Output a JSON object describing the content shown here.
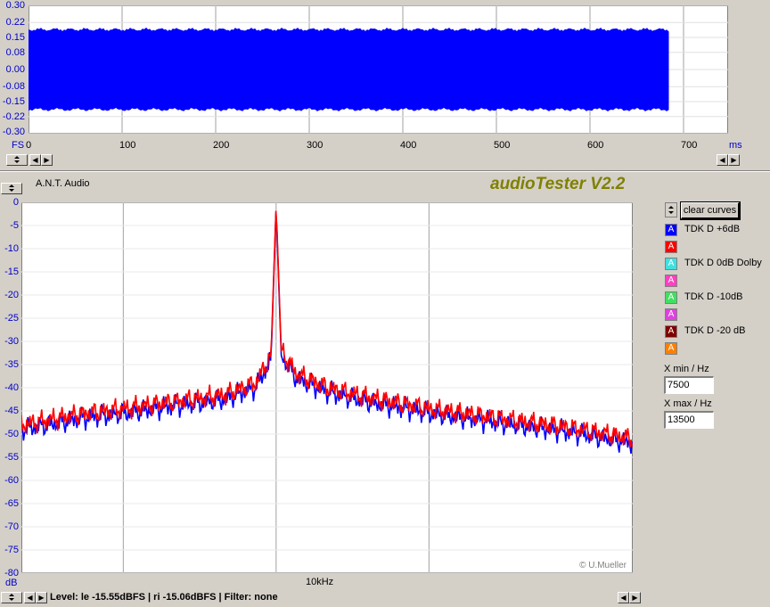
{
  "app_title": "audioTester V2.2",
  "device_label": "A.N.T. Audio",
  "copyright": "© U.Mueller",
  "status_text": "Level: le -15.55dBFS | ri -15.06dBFS | Filter: none",
  "clear_button": "clear curves",
  "legend": [
    {
      "label": "TDK D +6dB",
      "color": "#0000ff",
      "letter": "A"
    },
    {
      "label": "",
      "color": "#ff0000",
      "letter": "A"
    },
    {
      "label": "TDK D 0dB Dolby",
      "color": "#40e0e0",
      "letter": "A"
    },
    {
      "label": "",
      "color": "#ff40c0",
      "letter": "A"
    },
    {
      "label": "TDK D -10dB",
      "color": "#40e060",
      "letter": "A"
    },
    {
      "label": "",
      "color": "#e040e0",
      "letter": "A"
    },
    {
      "label": "TDK D -20 dB",
      "color": "#800000",
      "letter": "A"
    },
    {
      "label": "",
      "color": "#ff8000",
      "letter": "A"
    }
  ],
  "x_min": {
    "label": "X min / Hz",
    "value": "7500"
  },
  "x_max": {
    "label": "X max / Hz",
    "value": "13500"
  },
  "chart_data": [
    {
      "type": "area",
      "series_color": "#0000ff",
      "y_unit": "FS",
      "x_unit": "ms",
      "xlim": [
        0,
        700
      ],
      "ylim": [
        -0.3,
        0.3
      ],
      "y_ticks": [
        "0.30",
        "0.22",
        "0.15",
        "0.08",
        "0.00",
        "-0.08",
        "-0.15",
        "-0.22",
        "-0.30"
      ],
      "x_ticks": [
        "0",
        "100",
        "200",
        "300",
        "400",
        "500",
        "600",
        "700"
      ],
      "envelope": {
        "x_end": 684,
        "upper": 0.185,
        "lower": -0.185
      }
    },
    {
      "type": "line",
      "xlabel": "10kHz",
      "y_unit": "dB",
      "xlim": [
        7500,
        13500
      ],
      "ylim": [
        -80,
        0
      ],
      "y_ticks": [
        "0",
        "-5",
        "-10",
        "-15",
        "-20",
        "-25",
        "-30",
        "-35",
        "-40",
        "-45",
        "-50",
        "-55",
        "-60",
        "-65",
        "-70",
        "-75",
        "-80"
      ],
      "series": [
        {
          "color": "#0000ff",
          "x": [
            7500,
            8000,
            8500,
            9000,
            9500,
            9800,
            9950,
            10000,
            10050,
            10200,
            10500,
            11000,
            11500,
            12000,
            12500,
            13000,
            13500
          ],
          "values": [
            -49,
            -47,
            -45.5,
            -44,
            -42.5,
            -40,
            -34,
            -1,
            -33,
            -38,
            -41,
            -43.5,
            -45.5,
            -47,
            -48.5,
            -50,
            -52
          ]
        },
        {
          "color": "#ff0000",
          "x": [
            7500,
            8000,
            8500,
            9000,
            9500,
            9800,
            9950,
            10000,
            10050,
            10200,
            10500,
            11000,
            11500,
            12000,
            12500,
            13000,
            13500
          ],
          "values": [
            -48,
            -46,
            -44.5,
            -43,
            -41.5,
            -39,
            -33,
            -0.5,
            -32,
            -37,
            -40,
            -42.5,
            -44.5,
            -46,
            -47.5,
            -49,
            -51
          ]
        }
      ]
    }
  ]
}
